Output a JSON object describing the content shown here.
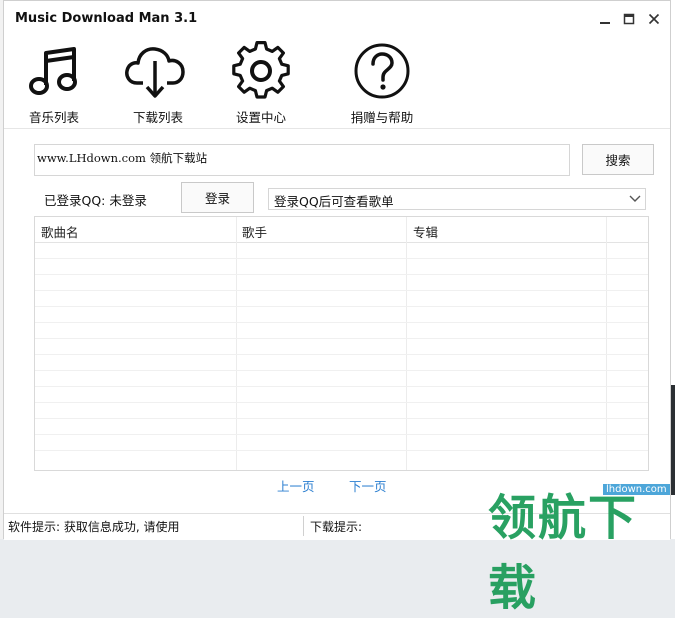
{
  "window": {
    "title": "Music Download Man 3.1"
  },
  "toolbar": {
    "items": [
      {
        "label": "音乐列表",
        "icon": "music-note-icon"
      },
      {
        "label": "下载列表",
        "icon": "cloud-download-icon"
      },
      {
        "label": "设置中心",
        "icon": "gear-icon"
      },
      {
        "label": "捐赠与帮助",
        "icon": "question-icon"
      }
    ]
  },
  "search": {
    "value": "www.LHdown.com  领航下载站",
    "button_label": "搜索"
  },
  "login": {
    "status_text": "已登录QQ: 未登录",
    "button_label": "登录",
    "playlist_select_value": "登录QQ后可查看歌单"
  },
  "table": {
    "columns": [
      "歌曲名",
      "歌手",
      "专辑"
    ]
  },
  "pager": {
    "prev_label": "上一页",
    "next_label": "下一页"
  },
  "statusbar": {
    "software_tip": "软件提示: 获取信息成功, 请使用",
    "download_tip": "下载提示:"
  },
  "watermark": {
    "text": "领航下载",
    "url": "lhdown.com"
  },
  "colors": {
    "link": "#2c7fd0",
    "watermark_green": "#1e9c5a"
  }
}
